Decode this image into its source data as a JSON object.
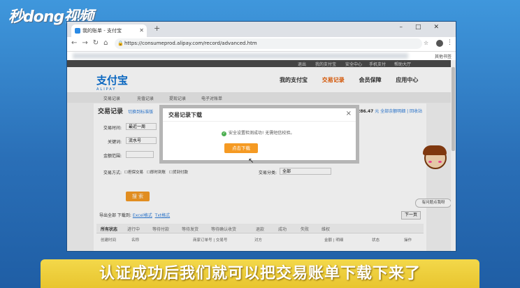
{
  "brand_watermark": "秒dong视频",
  "browser": {
    "tab_title": "我的账单 - 支付宝",
    "url": "https://consumeprod.alipay.com/record/advanced.htm",
    "bookmark": "其他书签"
  },
  "site": {
    "top_links": [
      "退出",
      "我的支付宝",
      "安全中心",
      "手机支付",
      "帮助大厅"
    ],
    "logo": "支付宝",
    "logo_sub": "ALIPAY",
    "nav": [
      "我的支付宝",
      "交易记录",
      "会员保障",
      "应用中心"
    ],
    "subnav": [
      "交易记录",
      "充值记录",
      "提现记录",
      "电子对账单"
    ]
  },
  "content": {
    "title": "交易记录",
    "switch_link": "切换到标准版",
    "summary_amount": "286.47",
    "summary_links": "元 全部余额明细 | 回收站",
    "fields": {
      "trade_time_label": "交易时间:",
      "trade_time_value": "最近一周",
      "keyword_label": "关键词:",
      "keyword_value": "流水号",
      "amount_label": "金额范围:",
      "method_label": "交易方式:",
      "method_options": [
        "担保交易",
        "即时到账",
        "货到付款"
      ],
      "category_label": "交易分类:",
      "category_value": "全部"
    },
    "search_button": "搜 索",
    "download_text": "导出全部 下载到:",
    "download_excel": "Excel格式",
    "download_txt": "Txt格式",
    "next_page": "下一页",
    "status_tabs": [
      "所有状态",
      "进行中",
      "等待付款",
      "等待发货",
      "等待确认收货",
      "退款",
      "成功",
      "失败",
      "维权"
    ],
    "table_headers": [
      "创建时间",
      "名称",
      "商家订单号 | 交易号",
      "对方",
      "金额 | 明细",
      "状态",
      "操作"
    ]
  },
  "dialog": {
    "title": "交易记录下载",
    "message": "安全设置检测成功! 无需短信校验。",
    "button": "点击下载"
  },
  "helper": {
    "help_label": "有问题点我呀"
  },
  "subtitle": "认证成功后我们就可以把交易账单下载下来了"
}
